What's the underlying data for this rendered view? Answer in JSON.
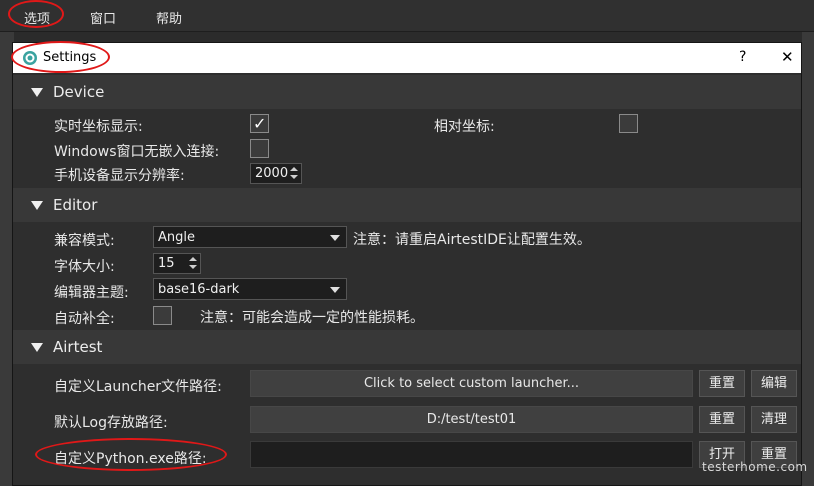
{
  "menu": {
    "items": [
      "选项",
      "窗口",
      "帮助"
    ]
  },
  "dialog": {
    "title": "Settings",
    "help_glyph": "?",
    "close_glyph": "✕"
  },
  "device": {
    "header": "Device",
    "realtime_coords_label": "实时坐标显示:",
    "realtime_coords_checked": true,
    "relative_coords_label": "相对坐标:",
    "relative_coords_checked": false,
    "windows_embed_label": "Windows窗口无嵌入连接:",
    "windows_embed_checked": false,
    "resolution_label": "手机设备显示分辨率:",
    "resolution_value": "2000"
  },
  "editor": {
    "header": "Editor",
    "compat_label": "兼容模式:",
    "compat_value": "Angle",
    "compat_note": "注意：请重启AirtestIDE让配置生效。",
    "font_size_label": "字体大小:",
    "font_size_value": "15",
    "theme_label": "编辑器主题:",
    "theme_value": "base16-dark",
    "autocomplete_label": "自动补全:",
    "autocomplete_checked": false,
    "autocomplete_note": "注意：可能会造成一定的性能损耗。"
  },
  "airtest": {
    "header": "Airtest",
    "launcher_label": "自定义Launcher文件路径:",
    "launcher_value": "Click to select custom launcher...",
    "launcher_reset": "重置",
    "launcher_edit": "编辑",
    "log_label": "默认Log存放路径:",
    "log_value": "D:/test/test01",
    "log_reset": "重置",
    "log_clear": "清理",
    "python_label": "自定义Python.exe路径:",
    "python_value": "",
    "python_open": "打开",
    "python_reset": "重置"
  },
  "watermark": "testerhome.com",
  "colors": {
    "highlight_ellipse": "#e01818",
    "dialog_bg": "#2e2e2e",
    "section_bg": "#383838"
  }
}
